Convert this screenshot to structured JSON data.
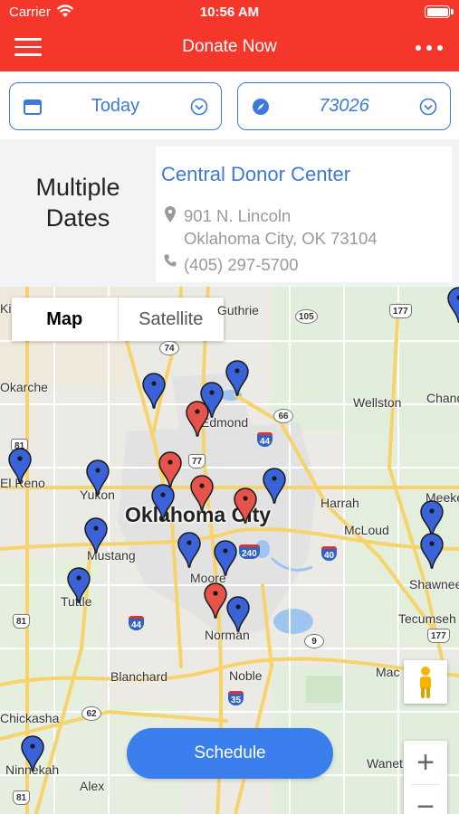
{
  "status_bar": {
    "carrier": "Carrier",
    "time": "10:56 AM"
  },
  "header": {
    "title": "Donate Now",
    "menu_icon": "hamburger-menu-icon",
    "more_icon": "more-dots-icon",
    "bg_color": "#f5362b"
  },
  "filters": {
    "date": {
      "label": "Today",
      "icon": "calendar-icon"
    },
    "location": {
      "label": "73026",
      "icon": "compass-icon"
    },
    "accent": "#3d79d9"
  },
  "info": {
    "dates_label_line1": "Multiple",
    "dates_label_line2": "Dates",
    "center_name": "Central Donor Center",
    "address_line1": "901 N. Lincoln",
    "address_line2": "Oklahoma City, OK 73104",
    "phone": "(405) 297-5700"
  },
  "map": {
    "type_control": {
      "map": "Map",
      "satellite": "Satellite",
      "selected": "Map"
    },
    "labels": {
      "guthrie": "Guthrie",
      "edmond": "Edmond",
      "wellston": "Wellston",
      "chandler": "Chand",
      "okarche": "Okarche",
      "el_reno": "El Reno",
      "yukon": "Yukon",
      "okc": "Oklahoma City",
      "harrah": "Harrah",
      "mcloud": "McLoud",
      "meeker": "Meeke",
      "mustang": "Mustang",
      "moore": "Moore",
      "shawnee": "Shawnee",
      "tuttle": "Tuttle",
      "norman": "Norman",
      "tecumseh": "Tecumseh",
      "blanchard": "Blanchard",
      "noble": "Noble",
      "macomb": "Mac",
      "chickasha": "Chickasha",
      "ninnekah": "Ninnekah",
      "alex": "Alex",
      "wanette": "Wanet",
      "kingfisher": "Ki"
    },
    "shields": [
      "177",
      "105",
      "74",
      "66",
      "44",
      "81",
      "77",
      "240",
      "40",
      "9",
      "81",
      "44",
      "35",
      "62",
      "81",
      "177"
    ],
    "blue_pin_count": 17,
    "red_pin_count": 5,
    "pin_colors": {
      "blue": "#3b63d9",
      "red": "#e5534b"
    }
  },
  "schedule_button": {
    "label": "Schedule"
  },
  "zoom": {
    "in": "+",
    "out": "−"
  }
}
